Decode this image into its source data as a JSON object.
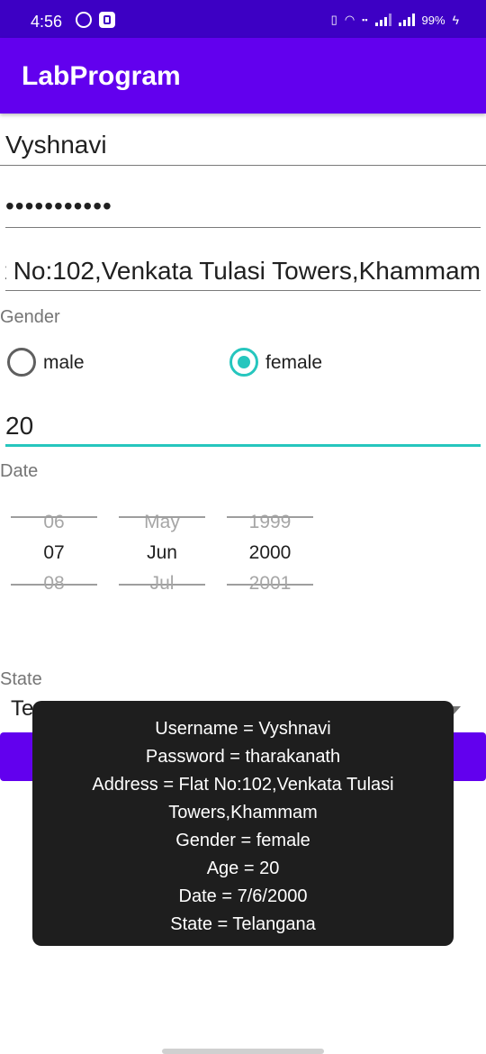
{
  "status_bar": {
    "time": "4:56",
    "battery": "99%",
    "icons": [
      "whatsapp-icon",
      "app-icon",
      "vibrate-icon",
      "wifi-icon",
      "volte-icon",
      "signal-icon",
      "signal-icon",
      "battery-charging-icon"
    ]
  },
  "app": {
    "title": "LabProgram"
  },
  "form": {
    "username": "Vyshnavi",
    "password_mask": "•••••••••••",
    "address": "Flat No:102,Venkata Tulasi Towers,Khammam",
    "gender_label": "Gender",
    "gender_options": {
      "male": "male",
      "female": "female"
    },
    "gender_selected": "female",
    "age": "20",
    "date_label": "Date",
    "date_picker": {
      "day": {
        "prev": "06",
        "selected": "07",
        "next": "08"
      },
      "month": {
        "prev": "May",
        "selected": "Jun",
        "next": "Jul"
      },
      "year": {
        "prev": "1999",
        "selected": "2000",
        "next": "2001"
      }
    },
    "state_label": "State",
    "state_visible_text": "Te"
  },
  "toast": {
    "lines": [
      "Username = Vyshnavi",
      "Password = tharakanath",
      "Address = Flat No:102,Venkata Tulasi",
      "Towers,Khammam",
      "Gender = female",
      "Age = 20",
      "Date = 7/6/2000",
      "State = Telangana"
    ]
  },
  "colors": {
    "status_bar": "#3d00c4",
    "primary": "#6200ee",
    "accent": "#26c6be",
    "toast_bg": "#1e1e1e"
  }
}
